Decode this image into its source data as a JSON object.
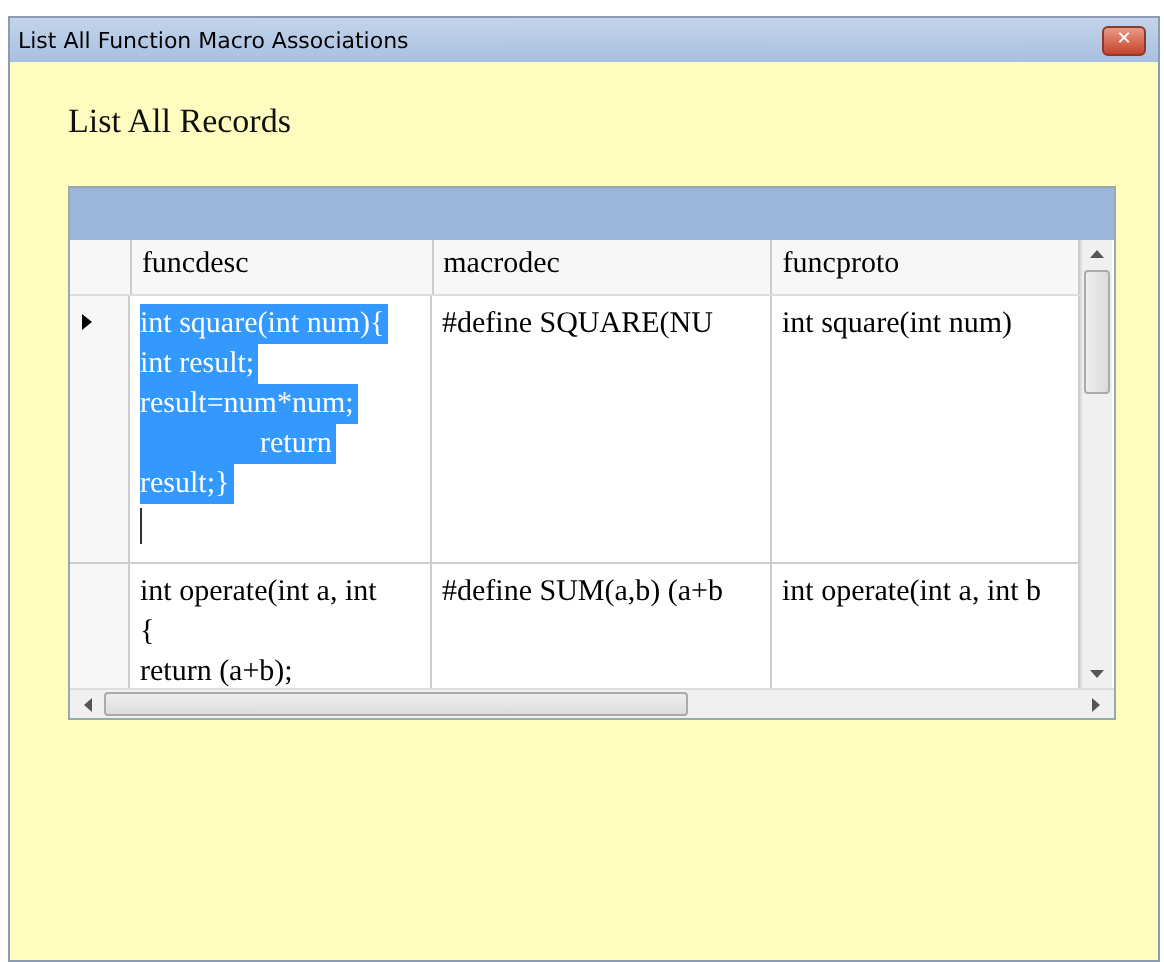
{
  "window": {
    "title": "List All Function Macro Associations",
    "close": "✕"
  },
  "heading": "List All Records",
  "table": {
    "columns": [
      "funcdesc",
      "macrodec",
      "funcproto"
    ],
    "rows": [
      {
        "selected": true,
        "cells": [
          [
            "int square(int num){",
            "int result;",
            "result=num*num;",
            "                return",
            "result;}"
          ],
          [
            "#define SQUARE(NU"
          ],
          [
            "int square(int num)"
          ]
        ]
      },
      {
        "selected": false,
        "cells": [
          [
            "int operate(int a, int",
            "{",
            "return (a+b);"
          ],
          [
            "#define SUM(a,b) (a+b"
          ],
          [
            "int operate(int a, int b"
          ]
        ]
      }
    ]
  }
}
